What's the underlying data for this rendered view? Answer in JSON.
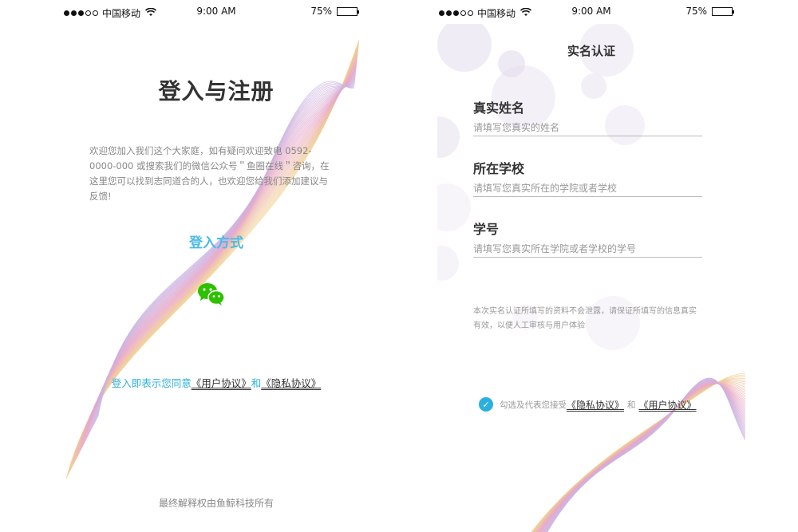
{
  "status_bar": {
    "carrier": "中国移动",
    "time": "9:00 AM",
    "battery": "75%",
    "battery_level": 0.75,
    "signal_filled": 3,
    "signal_total": 5
  },
  "login": {
    "title": "登入与注册",
    "description": "欢迎您加入我们这个大家庭，如有疑问欢迎致电 0592-0000-000 或搜索我们的微信公众号＂鱼圈在线＂咨询，在这里您可以找到志同道合的人，也欢迎您给我们添加建议与反馈!",
    "method_label": "登入方式",
    "wechat_icon": "wechat-icon",
    "agreement_prefix": "登入即表示您同意",
    "user_agreement": "《用户协议》",
    "agreement_and": "和",
    "privacy_agreement": "《隐私协议》",
    "footer": "最终解释权由鱼鲸科技所有"
  },
  "verify": {
    "title": "实名认证",
    "fields": [
      {
        "label": "真实姓名",
        "placeholder": "请填写您真实的姓名"
      },
      {
        "label": "所在学校",
        "placeholder": "请填写您真实所在的学院或者学校"
      },
      {
        "label": "学号",
        "placeholder": "请填写您真实所在学院或者学校的学号"
      }
    ],
    "privacy_note": "本次实名认证所填写的资料不会泄露，请保证所填写的信息真实有效，以便人工审核与用户体验",
    "accept_prefix": "勾选及代表您接受",
    "privacy_agreement": "《隐私协议》",
    "accept_and": "和",
    "user_agreement": "《用户协议》",
    "accept_checked": true
  },
  "colors": {
    "accent": "#2bb0de",
    "login_method": "#4bbbe6",
    "wechat": "#2dc100",
    "wave_warm": "#f2d08a",
    "wave_pink": "#e8a6c8",
    "wave_lilac": "#c7b6e6"
  }
}
